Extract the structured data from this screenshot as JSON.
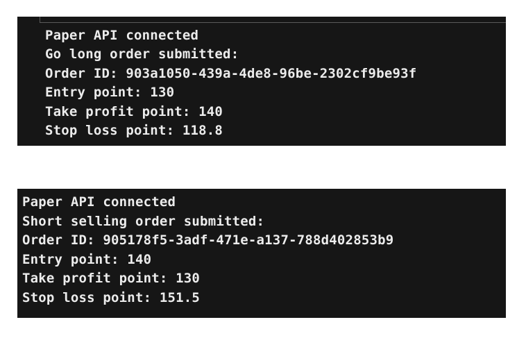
{
  "terminals": [
    {
      "lines": [
        "Paper API connected",
        "Go long order submitted:",
        "Order ID: 903a1050-439a-4de8-96be-2302cf9be93f",
        "Entry point: 130",
        "Take profit point: 140",
        "Stop loss point: 118.8"
      ]
    },
    {
      "lines": [
        "Paper API connected",
        "Short selling order submitted:",
        "Order ID: 905178f5-3adf-471e-a137-788d402853b9",
        "Entry point: 140",
        "Take profit point: 130",
        "Stop loss point: 151.5"
      ]
    }
  ],
  "colors": {
    "terminal_bg": "#161616",
    "terminal_text": "#ececec",
    "page_bg": "#ffffff"
  }
}
